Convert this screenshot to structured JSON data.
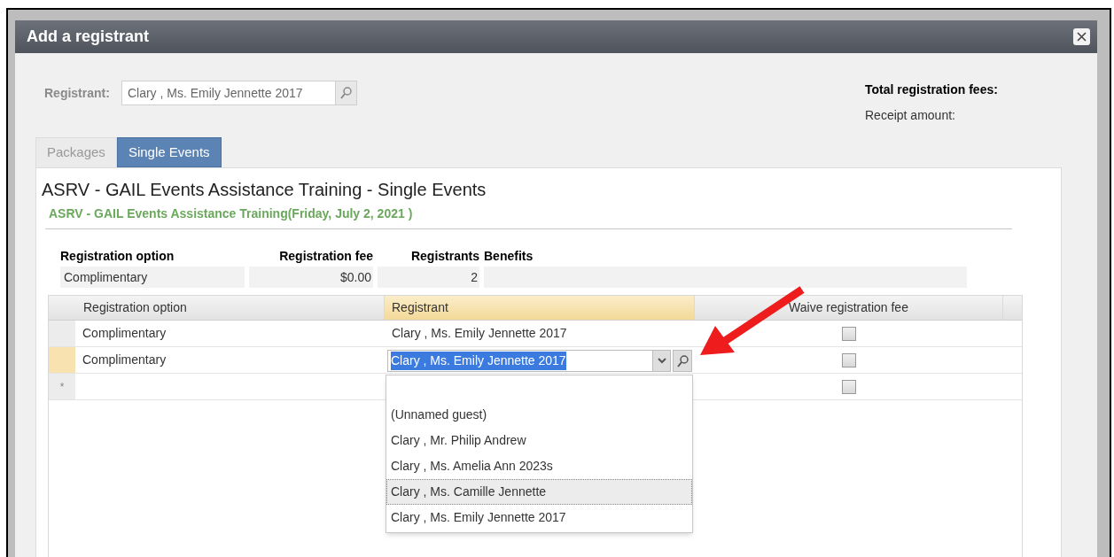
{
  "window": {
    "title": "Add a registrant"
  },
  "registrant": {
    "label": "Registrant:",
    "value": "Clary , Ms. Emily Jennette 2017"
  },
  "totals": {
    "fees_label": "Total registration fees:",
    "receipt_label": "Receipt amount:"
  },
  "tabs": [
    {
      "label": "Packages",
      "selected": false
    },
    {
      "label": "Single Events",
      "selected": true
    }
  ],
  "event": {
    "title": "ASRV - GAIL Events Assistance Training - Single Events",
    "subtitle": "ASRV - GAIL Events Assistance Training(Friday, July 2, 2021 )"
  },
  "summary": {
    "columns": [
      "Registration option",
      "Registration fee",
      "Registrants",
      "Benefits"
    ],
    "rows": [
      [
        "Complimentary",
        "$0.00",
        "2",
        ""
      ]
    ]
  },
  "grid": {
    "columns": [
      "Registration option",
      "Registrant",
      "Waive registration fee"
    ],
    "rows": [
      {
        "option": "Complimentary",
        "registrant": "Clary , Ms. Emily Jennette 2017",
        "waive": false,
        "editing": false
      },
      {
        "option": "Complimentary",
        "registrant": "Clary , Ms. Emily Jennette 2017",
        "waive": false,
        "editing": true
      },
      {
        "waive": false,
        "editing": false,
        "marker": "*"
      }
    ]
  },
  "dropdown": {
    "items": [
      {
        "label": "(Unnamed guest)",
        "selected": false
      },
      {
        "label": "Clary , Mr. Philip Andrew",
        "selected": false
      },
      {
        "label": "Clary , Ms. Amelia Ann 2023s",
        "selected": false
      },
      {
        "label": "Clary , Ms. Camille Jennette",
        "selected": true
      },
      {
        "label": "Clary , Ms. Emily Jennette 2017",
        "selected": false
      }
    ]
  }
}
